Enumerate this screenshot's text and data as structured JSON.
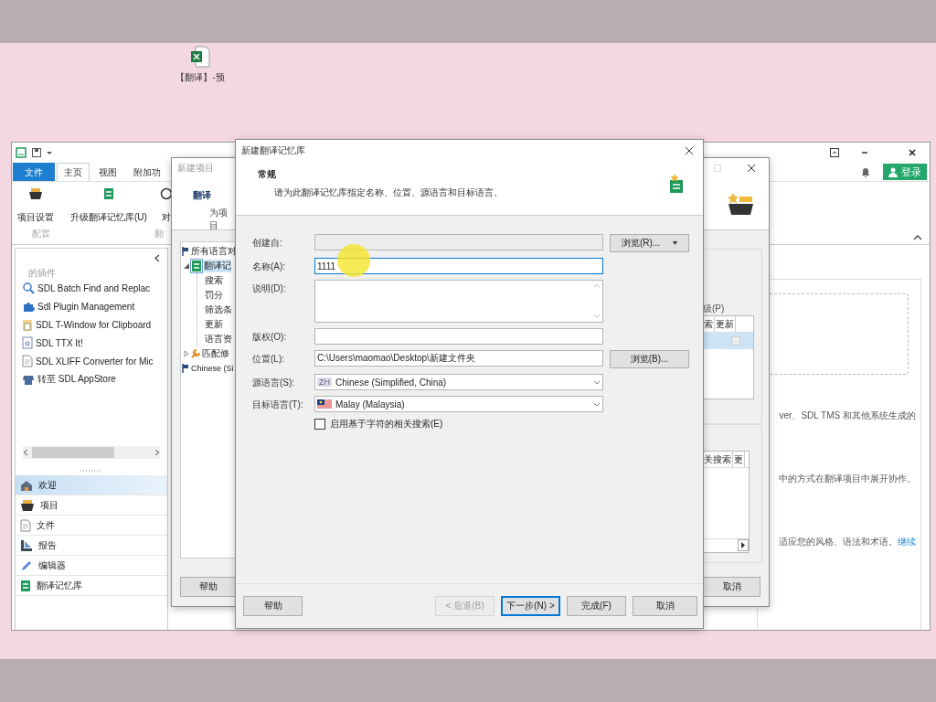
{
  "desktop_icon": {
    "label": "【翻译】-预"
  },
  "main_window": {
    "ribbon_tabs": [
      {
        "label": "文件",
        "kind": "file",
        "selected": false
      },
      {
        "label": "主页",
        "kind": "tab",
        "selected": true
      },
      {
        "label": "视图",
        "kind": "tab",
        "selected": false
      },
      {
        "label": "附加功",
        "kind": "tab",
        "selected": false
      }
    ],
    "login_button": "登录",
    "ribbon_buttons": [
      {
        "label": "项目设置",
        "kind": "basket"
      },
      {
        "label": "升级翻译记忆库(U)",
        "kind": "database"
      },
      {
        "label": "对",
        "kind": "circle"
      }
    ],
    "ribbon_groups": [
      "配置",
      "翻"
    ],
    "plugins_heading": "的插件",
    "plugins": [
      {
        "label": "SDL Batch Find and Replac",
        "kind": "search"
      },
      {
        "label": "Sdl Plugin Management",
        "kind": "puzzle"
      },
      {
        "label": "SDL T-Window for Clipboard",
        "kind": "clipboard"
      },
      {
        "label": "SDL TTX It!",
        "kind": "file"
      },
      {
        "label": "SDL XLIFF Converter for Mic",
        "kind": "page"
      },
      {
        "label": "转至 SDL AppStore",
        "kind": "store"
      }
    ],
    "nav_items": [
      {
        "label": "欢迎",
        "kind": "home",
        "selected": true
      },
      {
        "label": "项目",
        "kind": "basket",
        "selected": false
      },
      {
        "label": "文件",
        "kind": "page",
        "selected": false
      },
      {
        "label": "报告",
        "kind": "report",
        "selected": false
      },
      {
        "label": "编辑器",
        "kind": "pencil",
        "selected": false
      },
      {
        "label": "翻译记忆库",
        "kind": "database",
        "selected": false
      }
    ],
    "content_lines": [
      {
        "text": "ver、SDL TMS 和其他系统生成的"
      },
      {
        "text": "中的方式在翻译项目中展开协作。"
      },
      {
        "text": "适应您的风格、语法和术语。",
        "link": "继续"
      }
    ]
  },
  "project_dialog": {
    "title": "新建项目",
    "header_title": "翻译",
    "header_subtitle": "为项目",
    "tree": [
      {
        "label": "所有语言对",
        "kind": "flag",
        "selected": false,
        "children": [
          {
            "label": "翻译记",
            "kind": "database",
            "expanded": true,
            "selected": true,
            "children": [
              {
                "label": "搜索",
                "selected": false
              },
              {
                "label": "罚分",
                "selected": false
              },
              {
                "label": "筛选条",
                "selected": false
              },
              {
                "label": "更新",
                "selected": false
              },
              {
                "label": "语言资",
                "selected": false
              }
            ]
          },
          {
            "label": "匹配修",
            "kind": "wrench",
            "expanded": false,
            "selected": false
          }
        ]
      },
      {
        "label": "Chinese (Si",
        "kind": "flag",
        "selected": false
      }
    ],
    "upgrade_label": "级(P)",
    "table_1_columns": [
      "索",
      "更新"
    ],
    "table_1_rows": [
      {
        "selected": true,
        "checked": false
      }
    ],
    "table_2_columns": [
      "关搜索",
      "更"
    ],
    "buttons": [
      "帮助",
      "取消"
    ]
  },
  "tm_dialog": {
    "title": "新建翻译记忆库",
    "heading": "常规",
    "description": "请为此翻译记忆库指定名称、位置、源语言和目标语言。",
    "fields": [
      {
        "label": "创建自:",
        "kind": "text",
        "disabled": true,
        "focused": false,
        "button": {
          "label": "浏览(R)...",
          "menu": true
        }
      },
      {
        "label": "名称(A):",
        "kind": "text",
        "value": "1111",
        "disabled": false,
        "focused": true
      },
      {
        "label": "说明(D):",
        "kind": "textarea",
        "disabled": false,
        "focused": false
      },
      {
        "label": "版权(O):",
        "kind": "text",
        "disabled": false,
        "focused": false
      },
      {
        "label": "位置(L):",
        "kind": "text",
        "value": "C:\\Users\\maomao\\Desktop\\新建文件夹",
        "disabled": false,
        "focused": false,
        "button": {
          "label": "浏览(B)..."
        }
      },
      {
        "label": "源语言(S):",
        "kind": "select",
        "badge": "ZH",
        "value": "Chinese (Simplified, China)",
        "disabled": false,
        "focused": false
      },
      {
        "label": "目标语言(T):",
        "kind": "select",
        "flag": true,
        "value": "Malay (Malaysia)",
        "disabled": false,
        "focused": false
      }
    ],
    "checkbox": {
      "label": "启用基于字符的相关搜索(E)",
      "checked": false
    },
    "buttons": [
      {
        "label": "帮助",
        "disabled": false,
        "default": false
      },
      {
        "label": "< 后退(B)",
        "disabled": true,
        "default": false
      },
      {
        "label": "下一步(N) >",
        "disabled": false,
        "default": true
      },
      {
        "label": "完成(F)",
        "disabled": false,
        "default": false
      },
      {
        "label": "取消",
        "disabled": false,
        "default": false
      }
    ]
  }
}
